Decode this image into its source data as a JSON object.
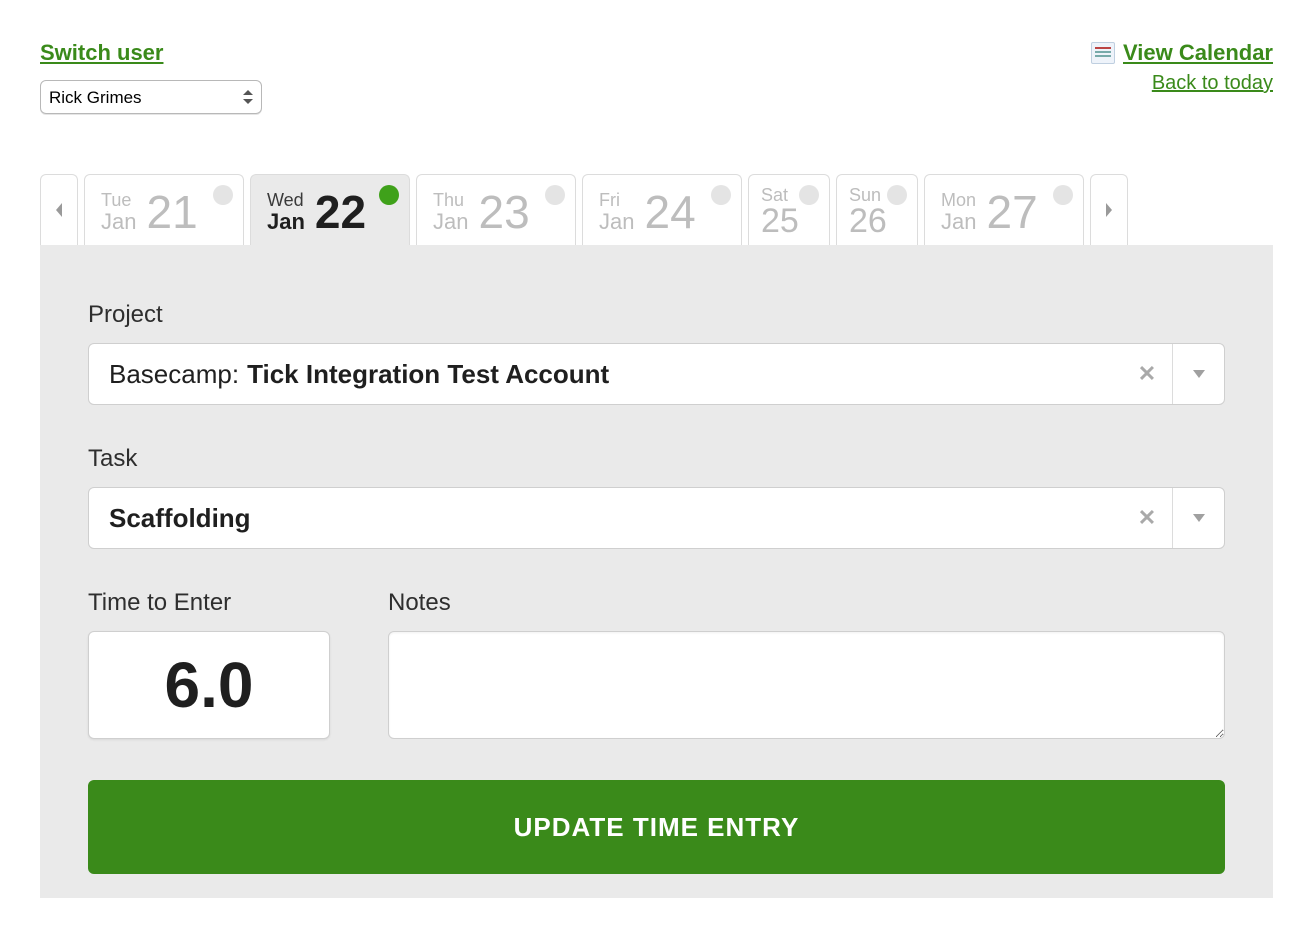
{
  "header": {
    "switch_user_label": "Switch user",
    "user_selected": "Rick Grimes",
    "view_calendar_label": "View Calendar",
    "back_to_today_label": "Back to today"
  },
  "dates": [
    {
      "weekday": "Tue",
      "month": "Jan",
      "day": "21",
      "active": false,
      "status": "idle"
    },
    {
      "weekday": "Wed",
      "month": "Jan",
      "day": "22",
      "active": true,
      "status": "has-entry"
    },
    {
      "weekday": "Thu",
      "month": "Jan",
      "day": "23",
      "active": false,
      "status": "idle"
    },
    {
      "weekday": "Fri",
      "month": "Jan",
      "day": "24",
      "active": false,
      "status": "idle"
    },
    {
      "weekday": "Sat",
      "month": "Jan",
      "day": "25",
      "active": false,
      "status": "idle",
      "size": "small"
    },
    {
      "weekday": "Sun",
      "month": "Jan",
      "day": "26",
      "active": false,
      "status": "idle",
      "size": "small"
    },
    {
      "weekday": "Mon",
      "month": "Jan",
      "day": "27",
      "active": false,
      "status": "idle"
    }
  ],
  "form": {
    "project_label": "Project",
    "project_prefix": "Basecamp:",
    "project_name": "Tick Integration Test Account",
    "task_label": "Task",
    "task_name": "Scaffolding",
    "time_label": "Time to Enter",
    "time_value": "6.0",
    "notes_label": "Notes",
    "notes_value": "",
    "submit_label": "UPDATE TIME ENTRY"
  }
}
